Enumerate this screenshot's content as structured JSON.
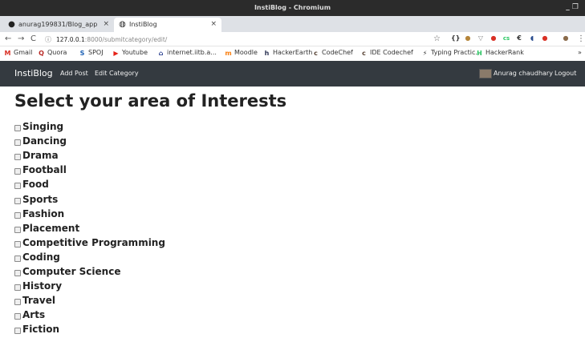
{
  "window": {
    "title": "InstiBlog - Chromium",
    "controls": "_ ❐"
  },
  "tabs": [
    {
      "label": "anurag199831/Blog_app",
      "icon": "github-icon",
      "close": "×"
    },
    {
      "label": "InstiBlog",
      "icon": "globe-icon",
      "close": "×"
    }
  ],
  "new_tab": "+",
  "toolbar": {
    "back": "←",
    "forward": "→",
    "reload": "C",
    "info": "ⓘ",
    "host": "127.0.0.1",
    "path": ":8000/submitcategory/edit/",
    "star": "☆",
    "menu": "⋮",
    "extensions": [
      "{}",
      "●",
      "▽",
      "●",
      "cs",
      "€",
      "◖",
      "●",
      "●"
    ]
  },
  "bookmarks": [
    {
      "label": "Gmail",
      "icon": "gmail-icon",
      "glyph": "M",
      "color": "#d93025"
    },
    {
      "label": "Quora",
      "icon": "quora-icon",
      "glyph": "Q",
      "color": "#b92b27"
    },
    {
      "label": "SPOJ",
      "icon": "spoj-icon",
      "glyph": "S",
      "color": "#1a5fb4"
    },
    {
      "label": "Youtube",
      "icon": "youtube-icon",
      "glyph": "▶",
      "color": "#e62117"
    },
    {
      "label": "internet.iitb.a...",
      "icon": "building-icon",
      "glyph": "⌂",
      "color": "#2a3f8f"
    },
    {
      "label": "Moodle",
      "icon": "moodle-icon",
      "glyph": "m",
      "color": "#f98012"
    },
    {
      "label": "HackerEarth",
      "icon": "hackerearth-icon",
      "glyph": "h",
      "color": "#2c3454"
    },
    {
      "label": "CodeChef",
      "icon": "codechef-icon",
      "glyph": "c",
      "color": "#5b4638"
    },
    {
      "label": "IDE Codechef",
      "icon": "codechef-icon",
      "glyph": "c",
      "color": "#5b4638"
    },
    {
      "label": "Typing Practic...",
      "icon": "bolt-icon",
      "glyph": "⚡",
      "color": "#333333"
    },
    {
      "label": "HackerRank",
      "icon": "hackerrank-icon",
      "glyph": "H",
      "color": "#2ec866"
    }
  ],
  "bookmarks_more": "»",
  "nav": {
    "brand": "InstiBlog",
    "links": [
      "Add Post",
      "Edit Category"
    ],
    "user": "Anurag chaudhary",
    "logout": "Logout",
    "bg_color": "#343a40"
  },
  "page": {
    "heading": "Select your area of Interests",
    "interests": [
      {
        "label": "Singing",
        "checked": false
      },
      {
        "label": "Dancing",
        "checked": false
      },
      {
        "label": "Drama",
        "checked": false
      },
      {
        "label": "Football",
        "checked": false
      },
      {
        "label": "Food",
        "checked": false
      },
      {
        "label": "Sports",
        "checked": false
      },
      {
        "label": "Fashion",
        "checked": false
      },
      {
        "label": "Placement",
        "checked": false
      },
      {
        "label": "Competitive Programming",
        "checked": false
      },
      {
        "label": "Coding",
        "checked": false
      },
      {
        "label": "Computer Science",
        "checked": false
      },
      {
        "label": "History",
        "checked": false
      },
      {
        "label": "Travel",
        "checked": false
      },
      {
        "label": "Arts",
        "checked": false
      },
      {
        "label": "Fiction",
        "checked": false
      }
    ]
  }
}
